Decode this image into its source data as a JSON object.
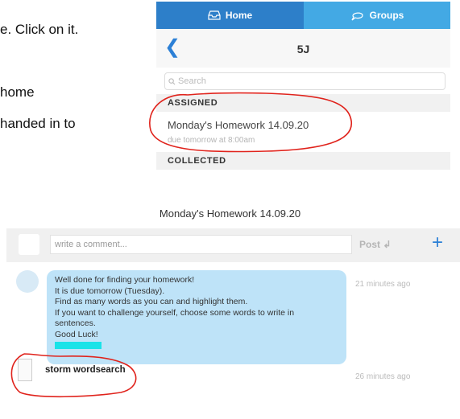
{
  "document": {
    "lines": [
      "e. Click on it.",
      "home",
      "handed in to"
    ]
  },
  "app": {
    "tabs": [
      {
        "label": "Home",
        "icon": "inbox-icon",
        "active": true
      },
      {
        "label": "Groups",
        "icon": "chat-bubble-icon",
        "active": false
      }
    ],
    "nav": {
      "back_icon": "chevron-left-icon",
      "title": "5J"
    },
    "search": {
      "placeholder": "Search"
    },
    "sections": {
      "assigned": "ASSIGNED",
      "collected": "COLLECTED"
    },
    "assigned_item": {
      "title": "Monday's Homework 14.09.20",
      "due": "due tomorrow at 8:00am"
    }
  },
  "post": {
    "heading": "Monday's Homework 14.09.20",
    "comment_placeholder": "write a comment...",
    "post_label": "Post",
    "add_label": "+",
    "message_lines": [
      "Well done for finding your homework!",
      "It is due tomorrow (Tuesday).",
      "Find as many words as you can and highlight them.",
      "If you want to challenge yourself, choose some words to write in",
      "sentences.",
      "Good Luck!"
    ],
    "message_time": "21 minutes ago",
    "attachment": {
      "name": "storm wordsearch",
      "time": "26 minutes ago"
    }
  },
  "colors": {
    "accent": "#43a9e4",
    "accent_dark": "#2d7fc9",
    "bubble": "#bee3f8",
    "highlight": "#1ae3e8",
    "annotation": "#e0231c"
  }
}
